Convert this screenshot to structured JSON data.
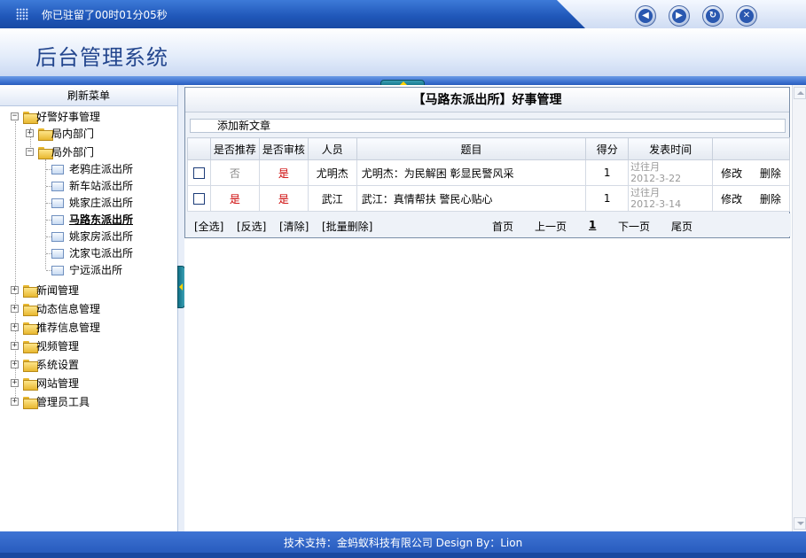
{
  "topbar": {
    "session_text": "你已驻留了00时01分05秒",
    "nav": [
      {
        "name": "back-icon",
        "glyph": "◀"
      },
      {
        "name": "forward-icon",
        "glyph": "▶"
      },
      {
        "name": "refresh-icon",
        "glyph": "↻"
      },
      {
        "name": "close-icon",
        "glyph": "✕"
      }
    ]
  },
  "header": {
    "title": "后台管理系统"
  },
  "sidebar": {
    "heading": "刷新菜单",
    "tree": {
      "root": "好警好事管理",
      "dept_inner": "局内部门",
      "dept_outer": "局外部门",
      "stations": [
        "老鸦庄派出所",
        "新车站派出所",
        "姚家庄派出所",
        "马路东派出所",
        "姚家房派出所",
        "沈家屯派出所",
        "宁远派出所"
      ],
      "selected_station": "马路东派出所",
      "top_level": [
        "新闻管理",
        "动态信息管理",
        "推荐信息管理",
        "视频管理",
        "系统设置",
        "网站管理",
        "管理员工具"
      ]
    }
  },
  "main": {
    "panel_title": "【马路东派出所】好事管理",
    "add_link": "添加新文章",
    "columns": [
      "是否推荐",
      "是否审核",
      "人员",
      "题目",
      "得分",
      "发表时间"
    ],
    "rows": [
      {
        "recommended": "否",
        "reviewed": "是",
        "person": "尤明杰",
        "title": "尤明杰：为民解困 彰显民警风采",
        "score": "1",
        "date_status": "过往月",
        "date": "2012-3-22",
        "edit": "修改",
        "delete": "删除"
      },
      {
        "recommended": "是",
        "reviewed": "是",
        "person": "武江",
        "title": "武江：真情帮扶 警民心贴心",
        "score": "1",
        "date_status": "过往月",
        "date": "2012-3-14",
        "edit": "修改",
        "delete": "删除"
      }
    ],
    "batch": {
      "select_all": "[全选]",
      "invert": "[反选]",
      "clear": "[清除]",
      "batch_delete": "[批量删除]"
    },
    "pager": {
      "first": "首页",
      "prev": "上一页",
      "current": "1",
      "next": "下一页",
      "last": "尾页"
    }
  },
  "footer": {
    "text": "技术支持：金蚂蚁科技有限公司  Design By：Lion"
  },
  "colors": {
    "brand_blue": "#2356b8",
    "title_blue": "#23468e",
    "alert_red": "#cc0000"
  }
}
